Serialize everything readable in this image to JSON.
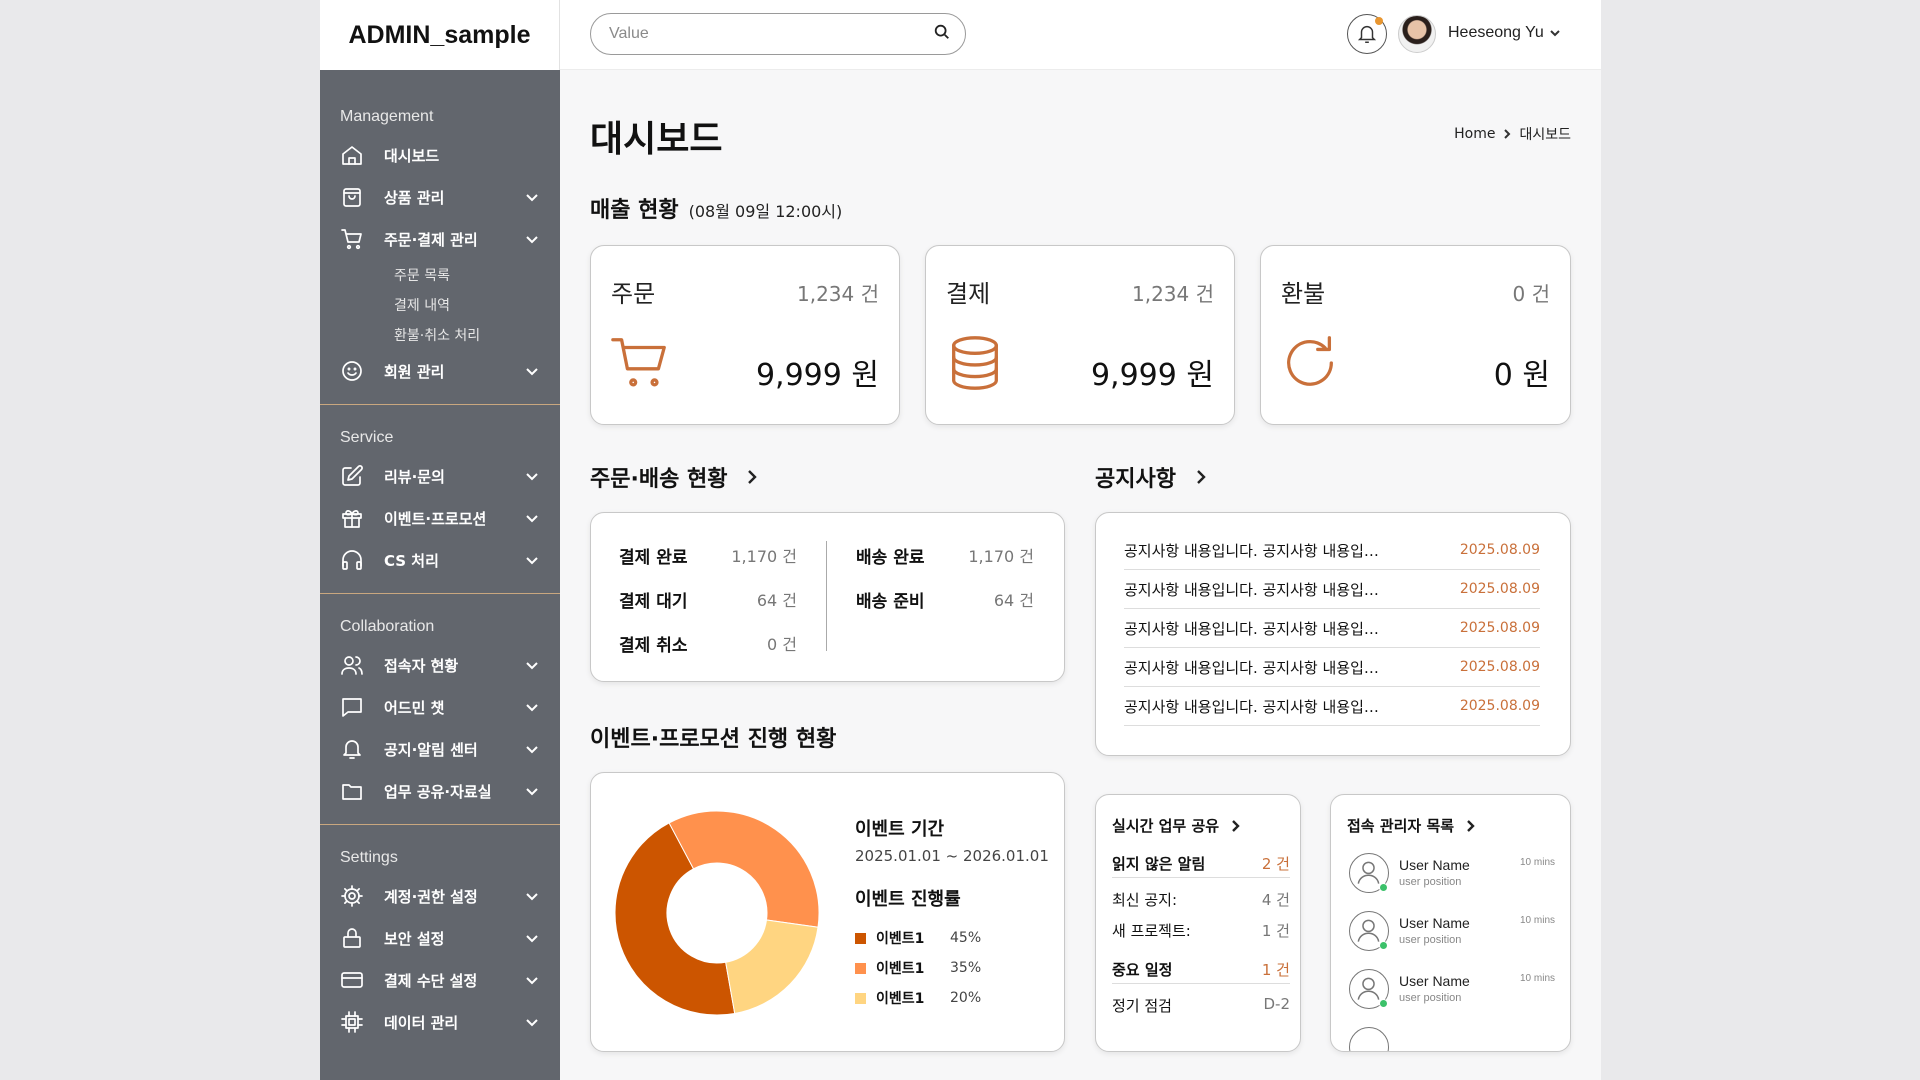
{
  "app": {
    "logo": "ADMIN_sample"
  },
  "search": {
    "placeholder": "Value"
  },
  "user": {
    "name": "Heeseong Yu"
  },
  "sidebar": {
    "sections": [
      {
        "head": "Management",
        "items": [
          {
            "label": "대시보드",
            "icon": "home-icon"
          },
          {
            "label": "상품 관리",
            "icon": "bag-icon"
          },
          {
            "label": "주문·결제 관리",
            "icon": "cart-icon",
            "subs": [
              "주문 목록",
              "결제 내역",
              "환불·취소 처리"
            ]
          },
          {
            "label": "회원 관리",
            "icon": "smile-icon"
          }
        ]
      },
      {
        "head": "Service",
        "items": [
          {
            "label": "리뷰·문의",
            "icon": "edit-icon"
          },
          {
            "label": "이벤트·프로모션",
            "icon": "gift-icon"
          },
          {
            "label": "CS 처리",
            "icon": "headset-icon"
          }
        ]
      },
      {
        "head": "Collaboration",
        "items": [
          {
            "label": "접속자 현황",
            "icon": "users-icon"
          },
          {
            "label": "어드민 챗",
            "icon": "chat-icon"
          },
          {
            "label": "공지·알림 센터",
            "icon": "bell-icon"
          },
          {
            "label": "업무 공유·자료실",
            "icon": "folder-icon"
          }
        ]
      },
      {
        "head": "Settings",
        "items": [
          {
            "label": "계정·권한 설정",
            "icon": "gear-icon"
          },
          {
            "label": "보안 설정",
            "icon": "lock-icon"
          },
          {
            "label": "결제 수단 설정",
            "icon": "card-icon"
          },
          {
            "label": "데이터 관리",
            "icon": "chip-icon"
          }
        ]
      }
    ]
  },
  "page": {
    "title": "대시보드",
    "breadcrumb": [
      "Home",
      "대시보드"
    ]
  },
  "sales": {
    "title": "매출 현황",
    "subtitle": "(08월 09일 12:00시)",
    "cards": [
      {
        "name": "주문",
        "count": "1,234 건",
        "amount": "9,999 원",
        "icon": "cart-icon"
      },
      {
        "name": "결제",
        "count": "1,234 건",
        "amount": "9,999 원",
        "icon": "database-icon"
      },
      {
        "name": "환불",
        "count": "0 건",
        "amount": "0 원",
        "icon": "refresh-icon"
      }
    ]
  },
  "orders": {
    "title": "주문·배송 현황",
    "left": [
      {
        "k": "결제 완료",
        "v": "1,170 건"
      },
      {
        "k": "결제 대기",
        "v": "64 건"
      },
      {
        "k": "결제 취소",
        "v": "0 건"
      }
    ],
    "right": [
      {
        "k": "배송 완료",
        "v": "1,170 건"
      },
      {
        "k": "배송 준비",
        "v": "64 건"
      }
    ]
  },
  "notices": {
    "title": "공지사항",
    "rows": [
      {
        "text": "공지사항 내용입니다. 공지사항 내용입…",
        "date": "2025.08.09"
      },
      {
        "text": "공지사항 내용입니다. 공지사항 내용입…",
        "date": "2025.08.09"
      },
      {
        "text": "공지사항 내용입니다. 공지사항 내용입…",
        "date": "2025.08.09"
      },
      {
        "text": "공지사항 내용입니다. 공지사항 내용입…",
        "date": "2025.08.09"
      },
      {
        "text": "공지사항 내용입니다. 공지사항 내용입…",
        "date": "2025.08.09"
      }
    ]
  },
  "events": {
    "title": "이벤트·프로모션 진행 현황",
    "period_label": "이벤트 기간",
    "period": "2025.01.01 ~ 2026.01.01",
    "progress_label": "이벤트 진행률",
    "legend": [
      {
        "name": "이벤트1",
        "pct": "45%",
        "value": 45,
        "color": "#cc5500"
      },
      {
        "name": "이벤트1",
        "pct": "35%",
        "value": 35,
        "color": "#ff914d"
      },
      {
        "name": "이벤트1",
        "pct": "20%",
        "value": 20,
        "color": "#ffd581"
      }
    ]
  },
  "realtime": {
    "title": "실시간 업무 공유",
    "rows": [
      {
        "k": "읽지 않은 알림",
        "v": "2 건",
        "bold": true,
        "orange": true
      },
      {
        "k": "최신 공지:",
        "v": "4 건"
      },
      {
        "k": "새 프로젝트:",
        "v": "1 건"
      },
      {
        "k": "중요 일정",
        "v": "1 건",
        "bold": true,
        "orange": true
      },
      {
        "k": "정기 점검",
        "v": "D-2"
      }
    ]
  },
  "admins": {
    "title": "접속 관리자 목록",
    "rows": [
      {
        "name": "User Name",
        "position": "user position",
        "time": "10 mins"
      },
      {
        "name": "User Name",
        "position": "user position",
        "time": "10 mins"
      },
      {
        "name": "User Name",
        "position": "user position",
        "time": "10 mins"
      }
    ]
  },
  "colors": {
    "accent": "#c9703a",
    "sidebar": "#62666d",
    "divider": "#c9a77f",
    "online": "#3cc16a"
  }
}
